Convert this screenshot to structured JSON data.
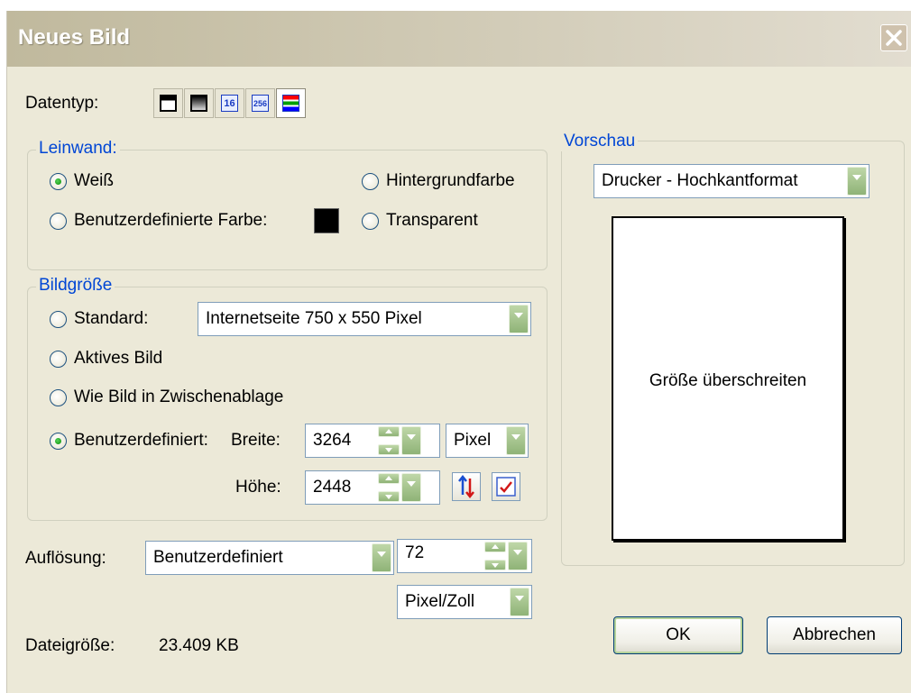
{
  "window": {
    "title": "Neues Bild"
  },
  "datentyp": {
    "label": "Datentyp:",
    "options": [
      "1-bit",
      "grayscale",
      "16",
      "256",
      "truecolor"
    ],
    "selected": "truecolor"
  },
  "leinwand": {
    "legend": "Leinwand:",
    "options": {
      "weiss": "Weiß",
      "hintergrund": "Hintergrundfarbe",
      "benutzer": "Benutzerdefinierte Farbe:",
      "transparent": "Transparent"
    },
    "selected": "weiss",
    "custom_color": "#000000"
  },
  "bildgroesse": {
    "legend": "Bildgröße",
    "standard_label": "Standard:",
    "standard_value": "Internetseite 750 x 550 Pixel",
    "aktives_label": "Aktives Bild",
    "zwischen_label": "Wie Bild in Zwischenablage",
    "benutzer_label": "Benutzerdefiniert:",
    "breite_label": "Breite:",
    "breite_value": "3264",
    "hoehe_label": "Höhe:",
    "hoehe_value": "2448",
    "unit": "Pixel",
    "selected": "benutzer"
  },
  "aufloesung": {
    "label": "Auflösung:",
    "mode": "Benutzerdefiniert",
    "value": "72",
    "unit": "Pixel/Zoll"
  },
  "dateigroesse": {
    "label": "Dateigröße:",
    "value": "23.409 KB"
  },
  "vorschau": {
    "legend": "Vorschau",
    "format": "Drucker - Hochkantformat",
    "message": "Größe überschreiten"
  },
  "buttons": {
    "ok": "OK",
    "cancel": "Abbrechen"
  },
  "colors": {
    "accent_green": "#8fb377",
    "legend_blue": "#0046d5",
    "dialog_bg": "#ece9d8"
  }
}
